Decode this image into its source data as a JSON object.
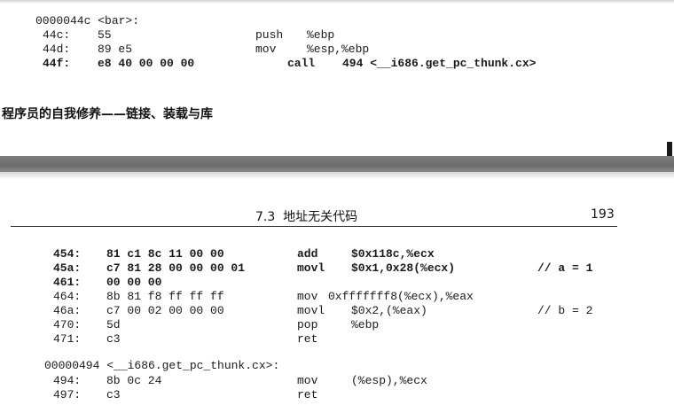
{
  "top_block": {
    "label": "0000044c <bar>:",
    "rows": [
      {
        "addr": "44c:",
        "bytes": "55",
        "mn": "push",
        "ops": "%ebp",
        "bold": false
      },
      {
        "addr": "44d:",
        "bytes": "89 e5",
        "mn": "mov",
        "ops": "%esp,%ebp",
        "bold": false
      },
      {
        "addr": "44f:",
        "bytes": "e8 40 00 00 00",
        "mn": "call",
        "ops": "494 <__i686.get_pc_thunk.cx>",
        "bold": true
      }
    ]
  },
  "footer_title": "程序员的自我修养——链接、装载与库",
  "header": {
    "section": "7.3  地址无关代码",
    "page_number": "193"
  },
  "main_block": {
    "rows": [
      {
        "addr": "454:",
        "bytes": "81 c1 8c 11 00 00",
        "mn": "add",
        "ops": "$0x118c,%ecx",
        "comment": "",
        "bold": true
      },
      {
        "addr": "45a:",
        "bytes": "c7 81 28 00 00 00 01",
        "mn": "movl",
        "ops": "$0x1,0x28(%ecx)",
        "comment": "// a = 1",
        "bold": true
      },
      {
        "addr": "461:",
        "bytes": "00 00 00",
        "mn": "",
        "ops": "",
        "comment": "",
        "bold": true
      },
      {
        "addr": "464:",
        "bytes": "8b 81 f8 ff ff ff",
        "mn": "mov",
        "ops": "0xfffffff8(%ecx),%eax",
        "comment": "",
        "bold": false
      },
      {
        "addr": "46a:",
        "bytes": "c7 00 02 00 00 00",
        "mn": "movl",
        "ops": "$0x2,(%eax)",
        "comment": "// b = 2",
        "bold": false
      },
      {
        "addr": "470:",
        "bytes": "5d",
        "mn": "pop",
        "ops": "%ebp",
        "comment": "",
        "bold": false
      },
      {
        "addr": "471:",
        "bytes": "c3",
        "mn": "ret",
        "ops": "",
        "comment": "",
        "bold": false
      }
    ],
    "label": "00000494 <__i686.get_pc_thunk.cx>:",
    "rows2": [
      {
        "addr": "494:",
        "bytes": "8b 0c 24",
        "mn": "mov",
        "ops": "(%esp),%ecx",
        "bold": false
      },
      {
        "addr": "497:",
        "bytes": "c3",
        "mn": "ret",
        "ops": "",
        "bold": false
      }
    ]
  }
}
